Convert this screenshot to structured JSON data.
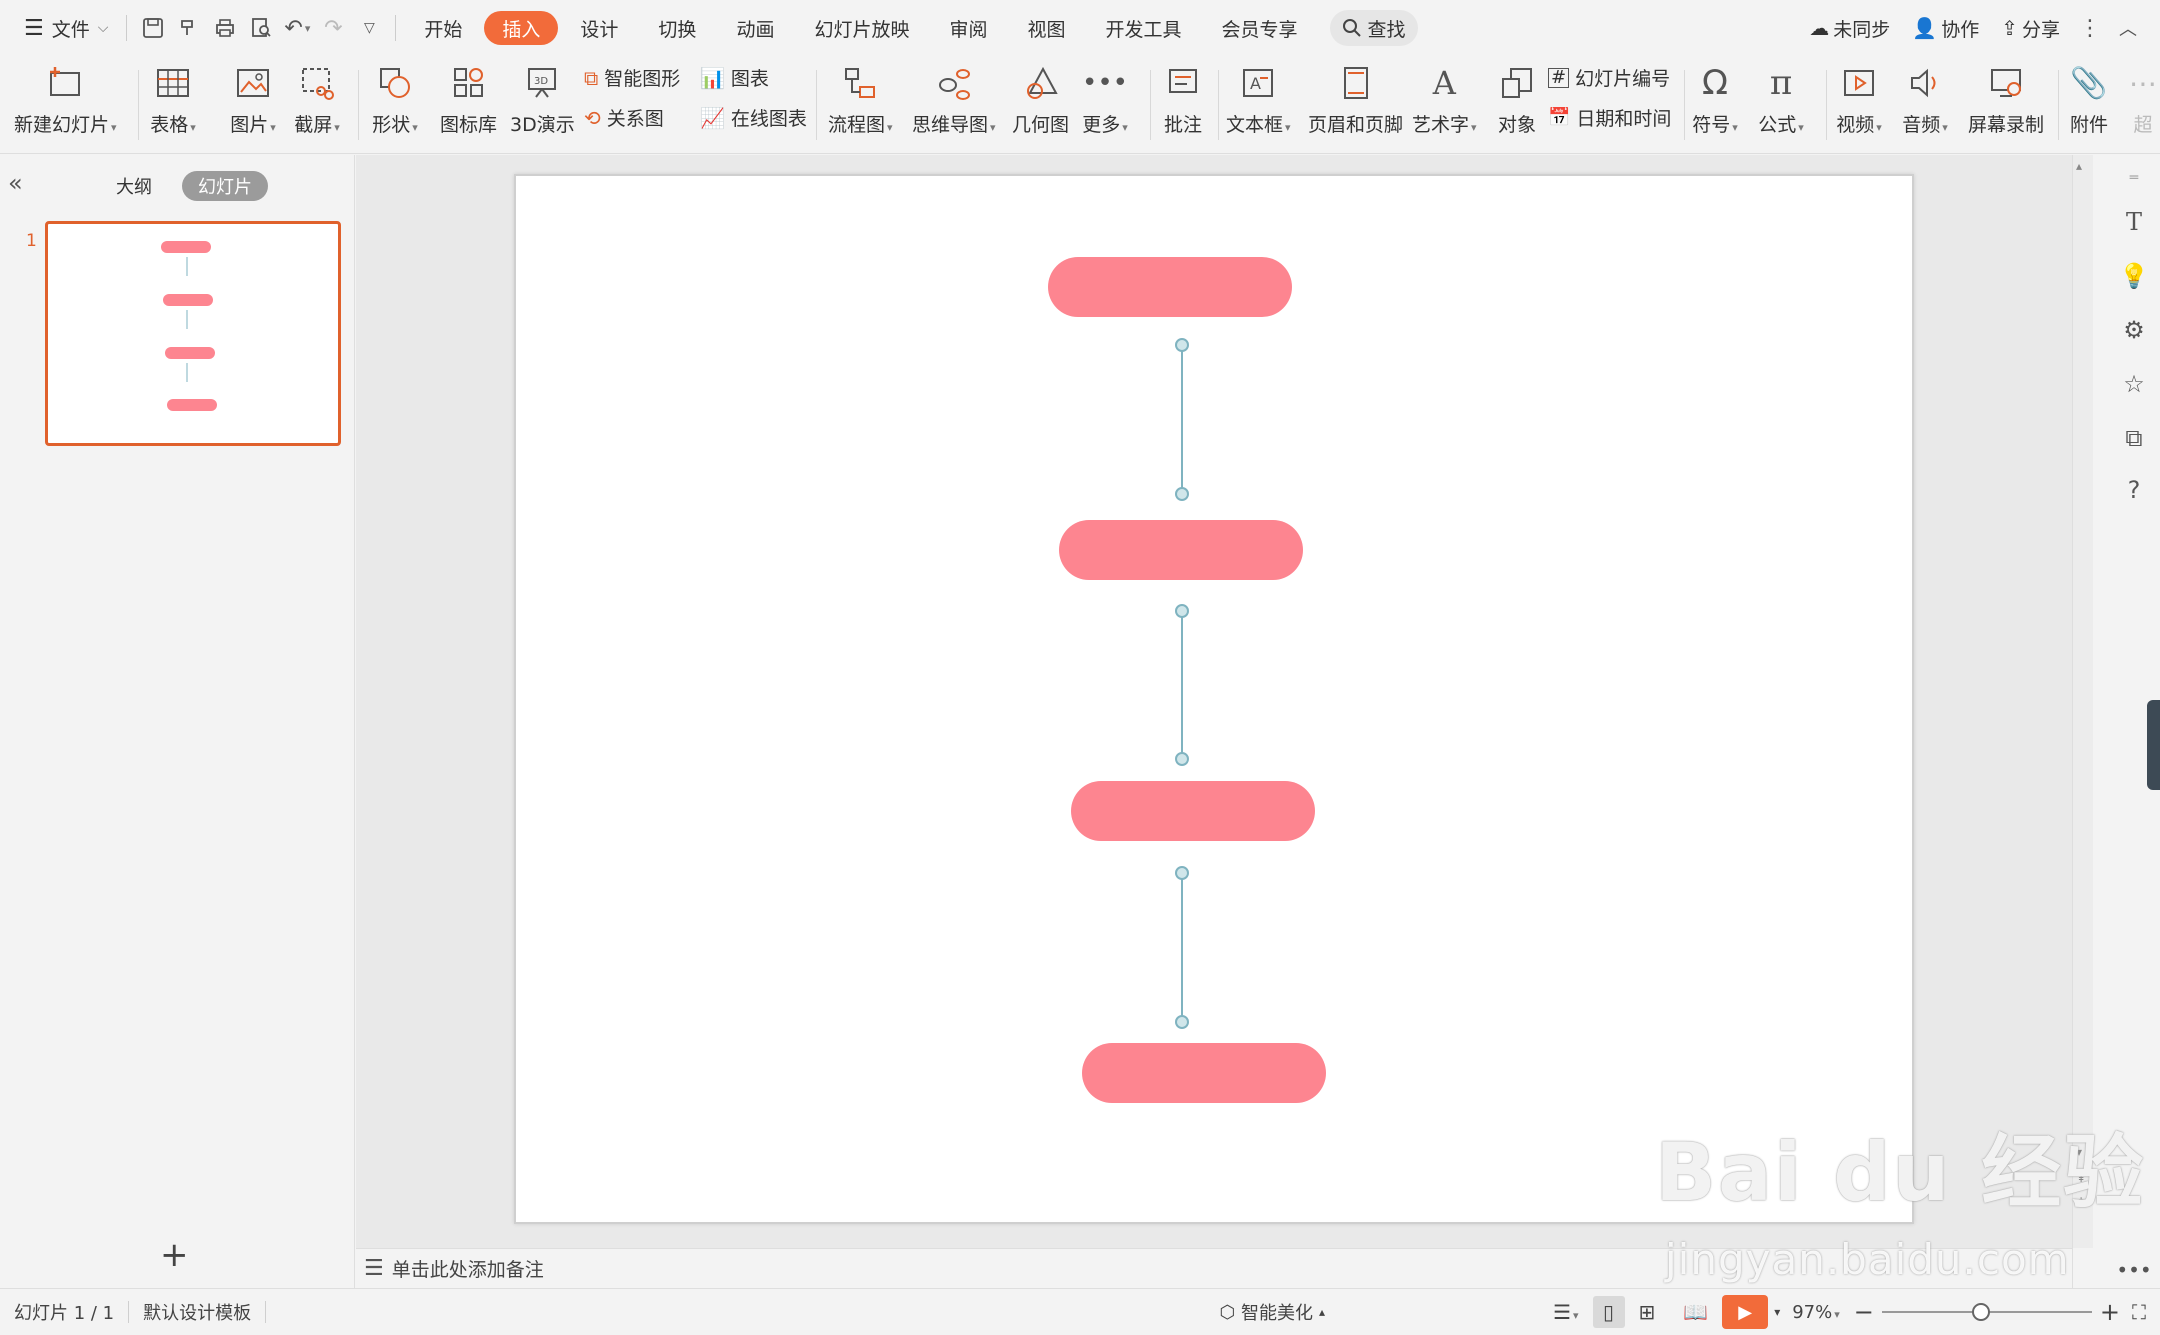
{
  "menubar": {
    "file_label": "文件",
    "tabs": [
      "开始",
      "插入",
      "设计",
      "切换",
      "动画",
      "幻灯片放映",
      "审阅",
      "视图",
      "开发工具",
      "会员专享"
    ],
    "active_tab": "插入",
    "search_label": "查找",
    "sync_label": "未同步",
    "collab_label": "协作",
    "share_label": "分享"
  },
  "ribbon": {
    "new_slide": "新建幻灯片",
    "table": "表格",
    "picture": "图片",
    "screenshot": "截屏",
    "shape": "形状",
    "icon_lib": "图标库",
    "demo3d": "3D演示",
    "smart_art": "智能图形",
    "relation": "关系图",
    "chart": "图表",
    "online_chart": "在线图表",
    "flowchart": "流程图",
    "mindmap": "思维导图",
    "geometry": "几何图",
    "more": "更多",
    "comment": "批注",
    "textbox": "文本框",
    "header_footer": "页眉和页脚",
    "wordart": "艺术字",
    "object": "对象",
    "slide_number": "幻灯片编号",
    "datetime": "日期和时间",
    "symbol": "符号",
    "formula": "公式",
    "video": "视频",
    "audio": "音频",
    "screen_record": "屏幕录制",
    "attachment": "附件",
    "overflow": "超"
  },
  "left_panel": {
    "tab_outline": "大纲",
    "tab_slides": "幻灯片",
    "slide_number": "1",
    "add_label": "+"
  },
  "notes": {
    "placeholder": "单击此处添加备注"
  },
  "statusbar": {
    "slide_info": "幻灯片 1 / 1",
    "template": "默认设计模板",
    "smart_beautify": "智能美化",
    "zoom": "97%"
  },
  "watermark": {
    "brand": "Bai du 经验",
    "url": "jingyan.baidu.com"
  },
  "colors": {
    "accent": "#f26b3a",
    "pill_fill": "#fd8590",
    "connector": "#7fb3c0",
    "selection": "#e0612c"
  }
}
